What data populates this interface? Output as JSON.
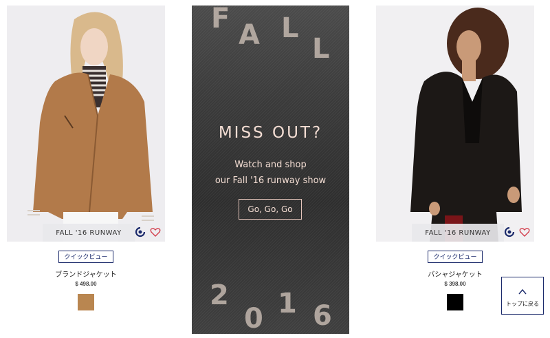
{
  "products": [
    {
      "badge": "FALL '16 RUNWAY",
      "quickview": "クイックビュー",
      "name": "ブランドジャケット",
      "price": "$ 498.00",
      "swatch_color": "#b98650"
    },
    {
      "badge": "FALL '16 RUNWAY",
      "quickview": "クイックビュー",
      "name": "バシャジャケット",
      "price": "$ 398.00",
      "swatch_color": "#000000"
    }
  ],
  "promo": {
    "word_top": [
      "F",
      "A",
      "L",
      "L"
    ],
    "headline": "MISS OUT?",
    "sub_line1": "Watch and shop",
    "sub_line2": "our Fall '16 runway show",
    "cta": "Go, Go, Go",
    "year_digits": [
      "2",
      "0",
      "1",
      "6"
    ]
  },
  "back_to_top": {
    "label": "トップに戻る",
    "icon": "chevron-up-icon"
  },
  "colors": {
    "accent_navy": "#1b2a6b",
    "heart_red": "#d23b4a",
    "promo_text": "#f3ddd3"
  }
}
